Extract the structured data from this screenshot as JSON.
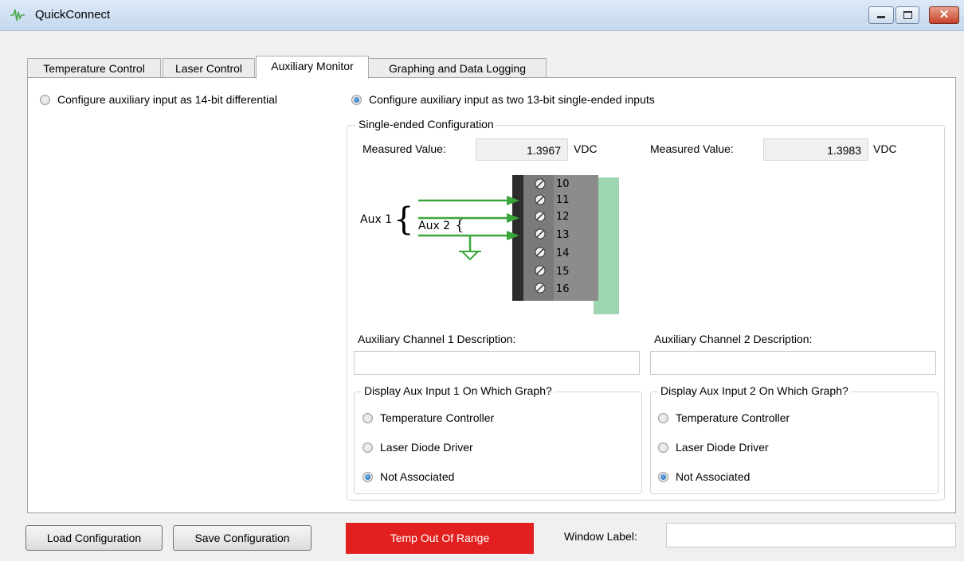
{
  "window": {
    "title": "QuickConnect"
  },
  "tabs": [
    {
      "label": "Temperature Control",
      "active": false
    },
    {
      "label": "Laser Control",
      "active": false
    },
    {
      "label": "Auxiliary Monitor",
      "active": true
    },
    {
      "label": "Graphing and Data Logging",
      "active": false
    }
  ],
  "mode": {
    "differential_label": "Configure auxiliary input as 14-bit differential",
    "differential_selected": false,
    "single_ended_label": "Configure auxiliary input as two 13-bit single-ended inputs",
    "single_ended_selected": true
  },
  "single_ended": {
    "group_title": "Single-ended Configuration",
    "measured_label_1": "Measured Value:",
    "measured_value_1": "1.3967",
    "unit_1": "VDC",
    "measured_label_2": "Measured Value:",
    "measured_value_2": "1.3983",
    "unit_2": "VDC"
  },
  "diagram": {
    "aux1_label": "Aux 1",
    "aux2_label": "Aux 2",
    "terminals": [
      "10",
      "11",
      "12",
      "13",
      "14",
      "15",
      "16"
    ]
  },
  "channel1": {
    "description_label": "Auxiliary Channel 1 Description:",
    "description_value": "",
    "graph_group_title": "Display Aux Input 1 On Which Graph?",
    "options": [
      "Temperature Controller",
      "Laser Diode Driver",
      "Not Associated"
    ],
    "selected": "Not Associated"
  },
  "channel2": {
    "description_label": "Auxiliary Channel 2 Description:",
    "description_value": "",
    "graph_group_title": "Display Aux Input 2 On Which Graph?",
    "options": [
      "Temperature Controller",
      "Laser Diode Driver",
      "Not Associated"
    ],
    "selected": "Not Associated"
  },
  "footer": {
    "load_label": "Load Configuration",
    "save_label": "Save Configuration",
    "status_text": "Temp Out Of Range",
    "status_color": "#e32020",
    "window_label_caption": "Window Label:",
    "window_label_value": ""
  }
}
